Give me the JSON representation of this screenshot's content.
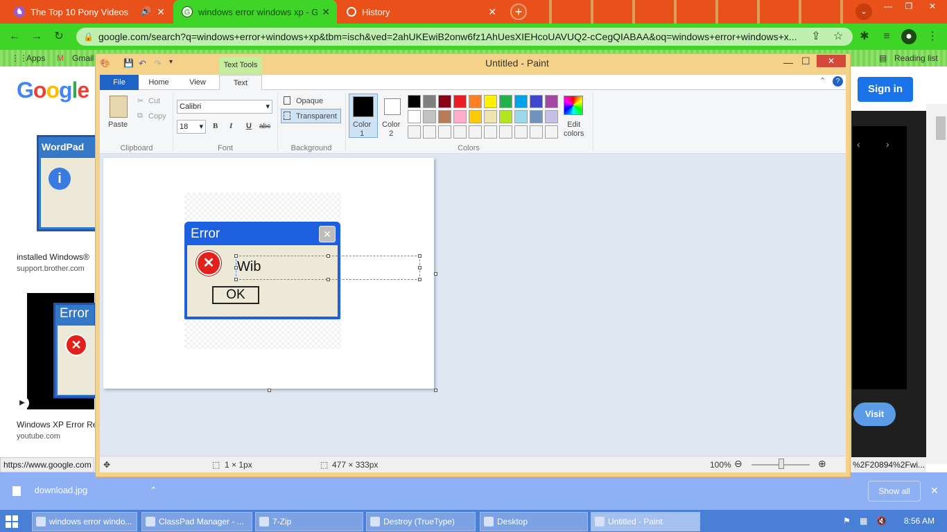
{
  "browser": {
    "tabs": [
      {
        "title": "The Top 10 Pony Videos",
        "active": false
      },
      {
        "title": "windows error windows xp - Goo",
        "active": true
      },
      {
        "title": "History",
        "active": false
      }
    ],
    "new_tab": "+",
    "url": "google.com/search?q=windows+error+windows+xp&tbm=isch&ved=2ahUKEwiB2onw6fz1AhUesXIEHcoUAVUQ2-cCegQIABAA&oq=windows+error+windows+x...",
    "bookmarks": [
      "Apps",
      "Gmail"
    ],
    "reading_list": "Reading list"
  },
  "google": {
    "logo": "Google",
    "sign_in": "Sign in",
    "visit": "Visit",
    "results": [
      {
        "thumb_title": "WordPad",
        "caption": "installed Windows®",
        "source": "support.brother.com"
      },
      {
        "thumb_title": "Error",
        "caption": "Windows XP Error Re",
        "source": "youtube.com"
      }
    ],
    "status_url_left": "https://www.google.com",
    "status_url_right": "%2F20894%2Fwi..."
  },
  "paint": {
    "title": "Untitled - Paint",
    "text_tools": "Text Tools",
    "tabs": {
      "file": "File",
      "home": "Home",
      "view": "View",
      "text": "Text"
    },
    "clipboard": {
      "paste": "Paste",
      "cut": "Cut",
      "copy": "Copy",
      "label": "Clipboard"
    },
    "font": {
      "family": "Calibri",
      "size": "18",
      "bold": "B",
      "italic": "I",
      "underline": "U",
      "strike": "abc",
      "label": "Font"
    },
    "background": {
      "opaque": "Opaque",
      "transparent": "Transparent",
      "label": "Background"
    },
    "colors": {
      "color1": "Color\n1",
      "color2": "Color\n2",
      "edit": "Edit\ncolors",
      "label": "Colors",
      "row1": [
        "#000000",
        "#7f7f7f",
        "#880015",
        "#ed1c24",
        "#ff7f27",
        "#fff200",
        "#22b14c",
        "#00a2e8",
        "#3f48cc",
        "#a349a4"
      ],
      "row2": [
        "#ffffff",
        "#c3c3c3",
        "#b97a57",
        "#ffaec9",
        "#ffc90e",
        "#efe4b0",
        "#b5e61d",
        "#99d9ea",
        "#7092be",
        "#c8bfe7"
      ]
    },
    "canvas": {
      "dialog_title": "Error",
      "dialog_close": "✕",
      "error_glyph": "✕",
      "text": "Wib",
      "ok": "OK"
    },
    "status": {
      "cursor": "1 × 1px",
      "size": "477 × 333px",
      "zoom": "100%"
    }
  },
  "downloads": {
    "file": "download.jpg",
    "show_all": "Show all"
  },
  "taskbar": {
    "items": [
      "windows error windo...",
      "ClassPad Manager - ...",
      "7-Zip",
      "Destroy (TrueType)",
      "Desktop",
      "Untitled - Paint"
    ],
    "clock": "8:56 AM"
  }
}
